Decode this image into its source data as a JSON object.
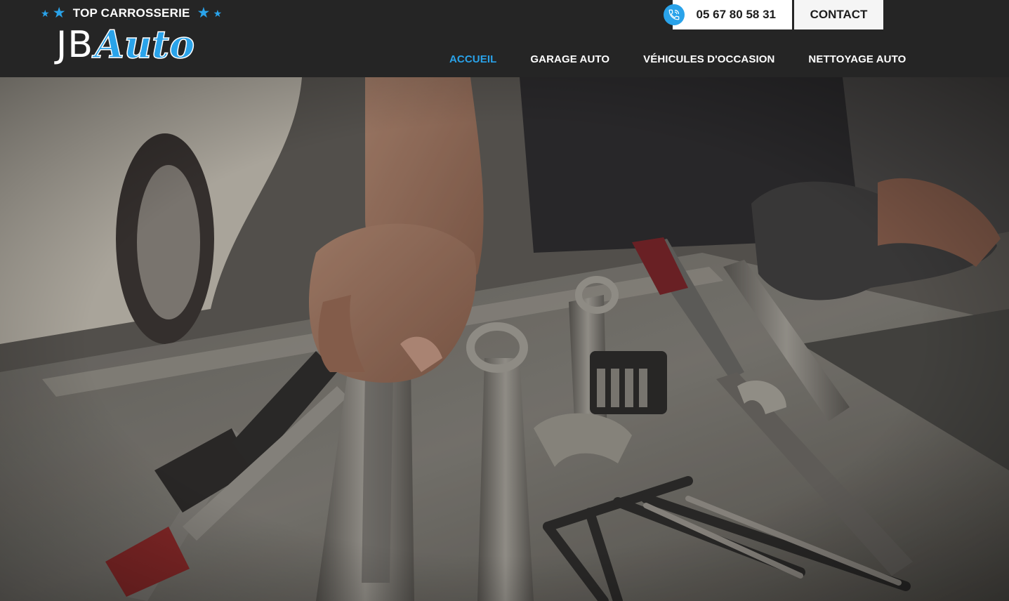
{
  "header": {
    "tagline": "TOP CARROSSERIE",
    "brand_first": "JB",
    "brand_second": "Auto",
    "phone": "05 67 80 58 31",
    "contact_label": "CONTACT"
  },
  "nav": {
    "items": [
      {
        "label": "ACCUEIL",
        "active": true
      },
      {
        "label": "GARAGE AUTO",
        "active": false
      },
      {
        "label": "VÉHICULES D'OCCASION",
        "active": false
      },
      {
        "label": "NETTOYAGE AUTO",
        "active": false
      }
    ]
  },
  "colors": {
    "accent": "#2aa3ea",
    "header_bg": "#252525"
  },
  "icons": {
    "phone": "phone-icon",
    "star": "star-icon"
  }
}
